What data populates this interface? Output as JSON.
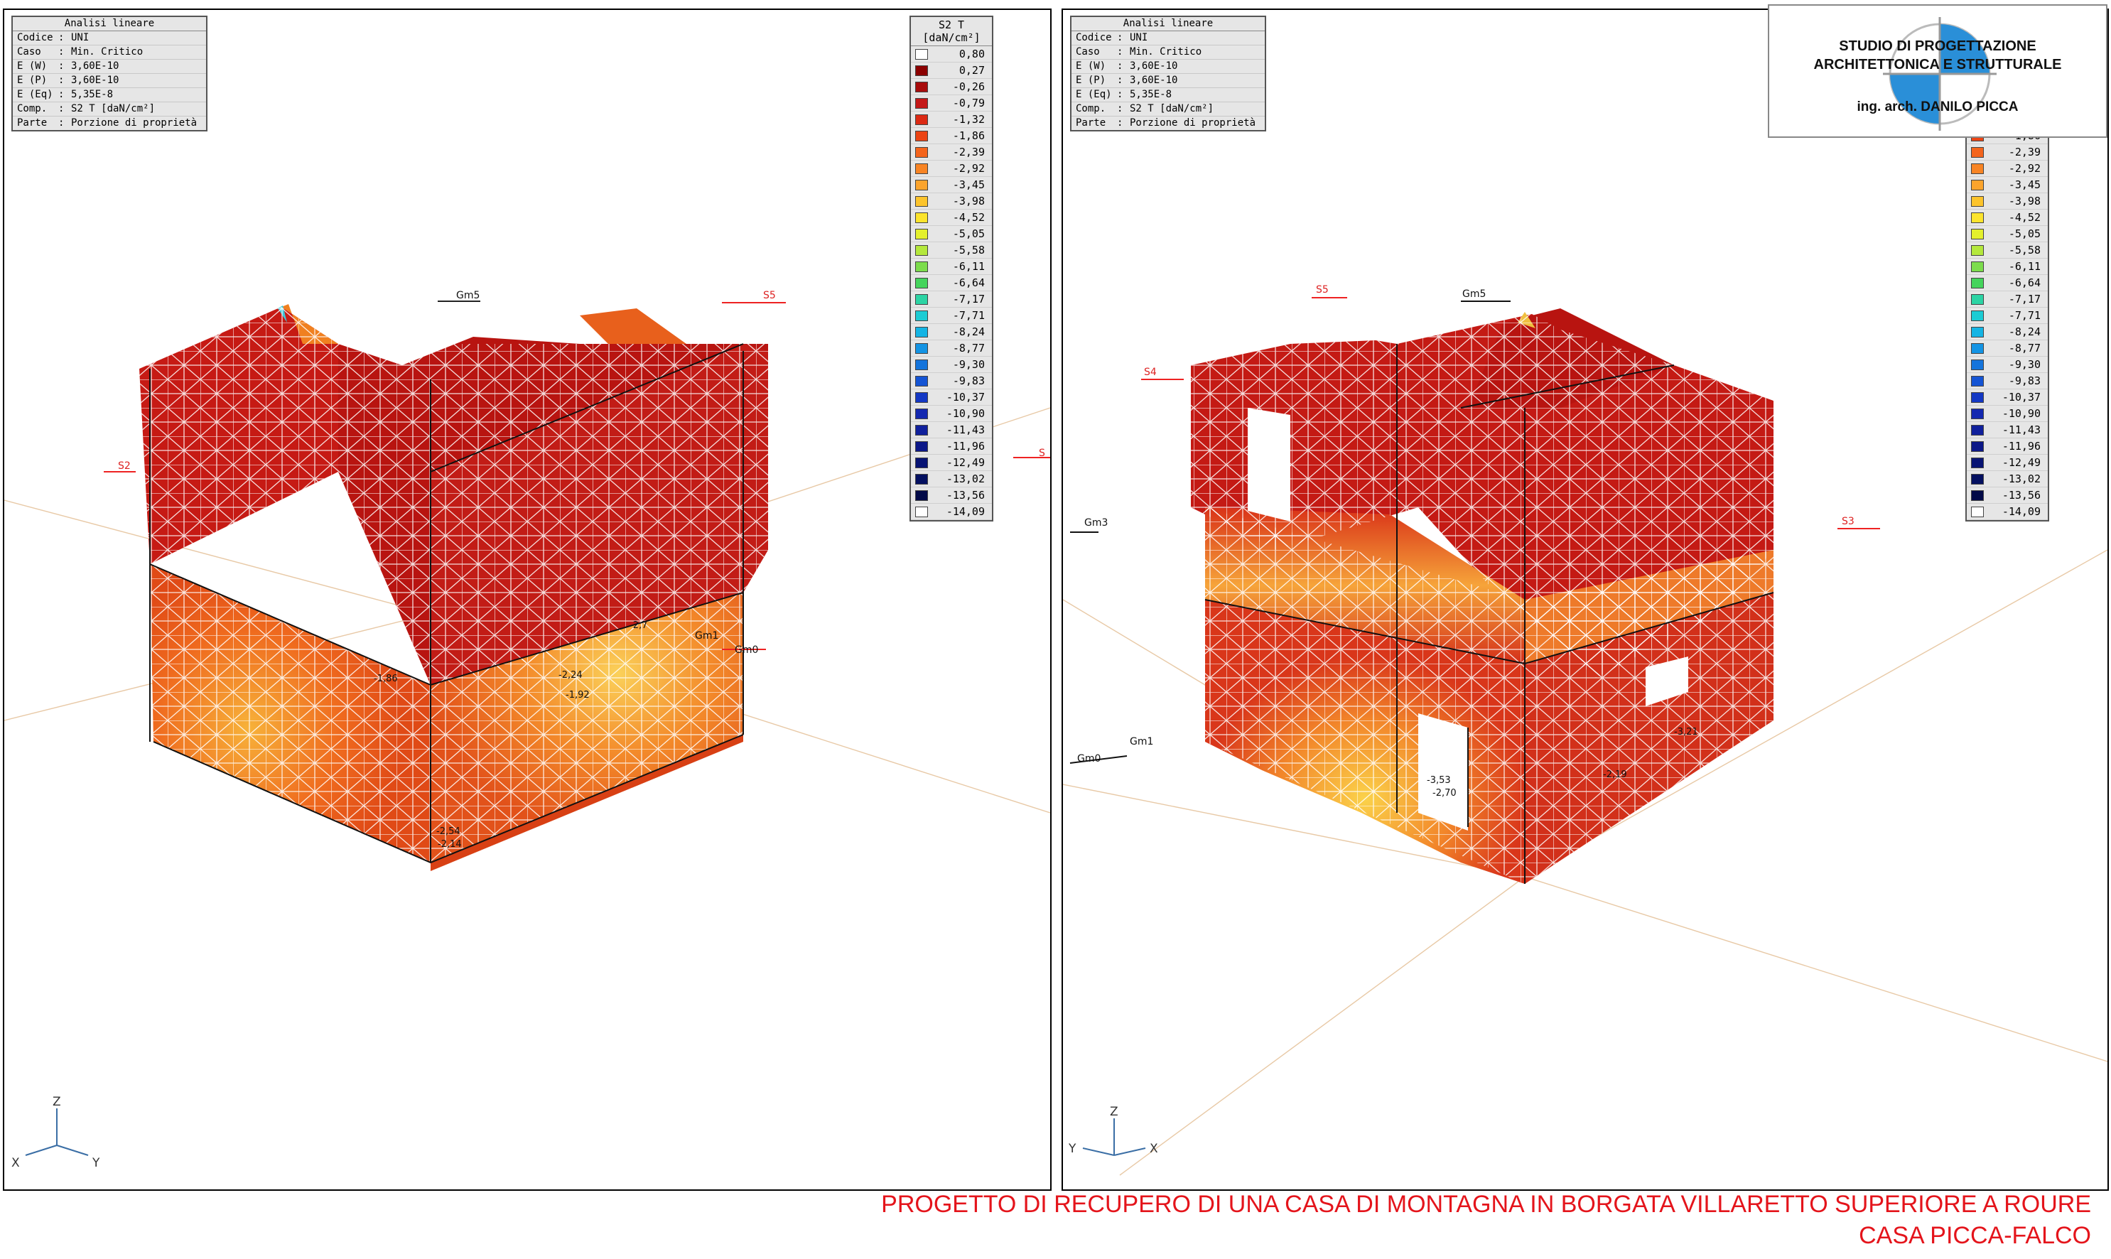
{
  "info_panel": {
    "title": "Analisi lineare",
    "rows": [
      {
        "key": "Codice",
        "sep": ":",
        "value": "UNI"
      },
      {
        "key": "Caso",
        "sep": ":",
        "value": "Min. Critico"
      },
      {
        "key": "E (W)",
        "sep": ":",
        "value": "3,60E-10"
      },
      {
        "key": "E (P)",
        "sep": ":",
        "value": "3,60E-10"
      },
      {
        "key": "E (Eq)",
        "sep": ":",
        "value": "5,35E-8"
      },
      {
        "key": "Comp.",
        "sep": ":",
        "value": "S2 T [daN/cm²]"
      },
      {
        "key": "Parte",
        "sep": ":",
        "value": "Porzione di proprietà"
      }
    ]
  },
  "legend": {
    "title": "S2 T",
    "unit": "[daN/cm²]",
    "entries": [
      {
        "value": "0,80",
        "color": "#ffffff"
      },
      {
        "value": "0,27",
        "color": "#8b0000"
      },
      {
        "value": "-0,26",
        "color": "#a80c0c"
      },
      {
        "value": "-0,79",
        "color": "#c41818"
      },
      {
        "value": "-1,32",
        "color": "#dc2a14"
      },
      {
        "value": "-1,86",
        "color": "#ec4414"
      },
      {
        "value": "-2,39",
        "color": "#f4641c"
      },
      {
        "value": "-2,92",
        "color": "#f88424"
      },
      {
        "value": "-3,45",
        "color": "#fca42c"
      },
      {
        "value": "-3,98",
        "color": "#fcc42c"
      },
      {
        "value": "-4,52",
        "color": "#fce42c"
      },
      {
        "value": "-5,05",
        "color": "#e4f02c"
      },
      {
        "value": "-5,58",
        "color": "#b4e83c"
      },
      {
        "value": "-6,11",
        "color": "#7cdc4c"
      },
      {
        "value": "-6,64",
        "color": "#44d45c"
      },
      {
        "value": "-7,17",
        "color": "#2cd4a4"
      },
      {
        "value": "-7,71",
        "color": "#1cccd4"
      },
      {
        "value": "-8,24",
        "color": "#14b4e4"
      },
      {
        "value": "-8,77",
        "color": "#1494e4"
      },
      {
        "value": "-9,30",
        "color": "#1474dc"
      },
      {
        "value": "-9,83",
        "color": "#1454d4"
      },
      {
        "value": "-10,37",
        "color": "#1438c4"
      },
      {
        "value": "-10,90",
        "color": "#1428b0"
      },
      {
        "value": "-11,43",
        "color": "#10209c"
      },
      {
        "value": "-11,96",
        "color": "#0c1888"
      },
      {
        "value": "-12,49",
        "color": "#081474"
      },
      {
        "value": "-13,02",
        "color": "#041060"
      },
      {
        "value": "-13,56",
        "color": "#020a48"
      },
      {
        "value": "-14,09",
        "color": "#ffffff"
      }
    ]
  },
  "left_view": {
    "axes": {
      "z": "Z",
      "x": "X",
      "y": "Y"
    },
    "tags": [
      "Gm5",
      "S5",
      "S2",
      "Gm0",
      "S",
      "Gm1"
    ],
    "values": [
      "-2,24",
      "-1,92",
      "-2,14",
      "-2,54",
      "-1,86",
      "-2,7"
    ]
  },
  "right_view": {
    "axes": {
      "z": "Z",
      "x": "X",
      "y": "Y"
    },
    "tags": [
      "S5",
      "Gm5",
      "S4",
      "Gm3",
      "S3",
      "Gm0",
      "Gm1"
    ],
    "values": [
      "-3,53",
      "-2,70",
      "-2,19",
      "-3,21"
    ]
  },
  "logo": {
    "line1": "STUDIO DI PROGETTAZIONE",
    "line2": "ARCHITETTONICA E STRUTTURALE",
    "line3": "ing. arch. DANILO PICCA"
  },
  "caption": {
    "line1": "PROGETTO DI RECUPERO DI UNA CASA DI MONTAGNA IN BORGATA VILLARETTO SUPERIORE A ROURE",
    "line2": "CASA PICCA-FALCO"
  }
}
